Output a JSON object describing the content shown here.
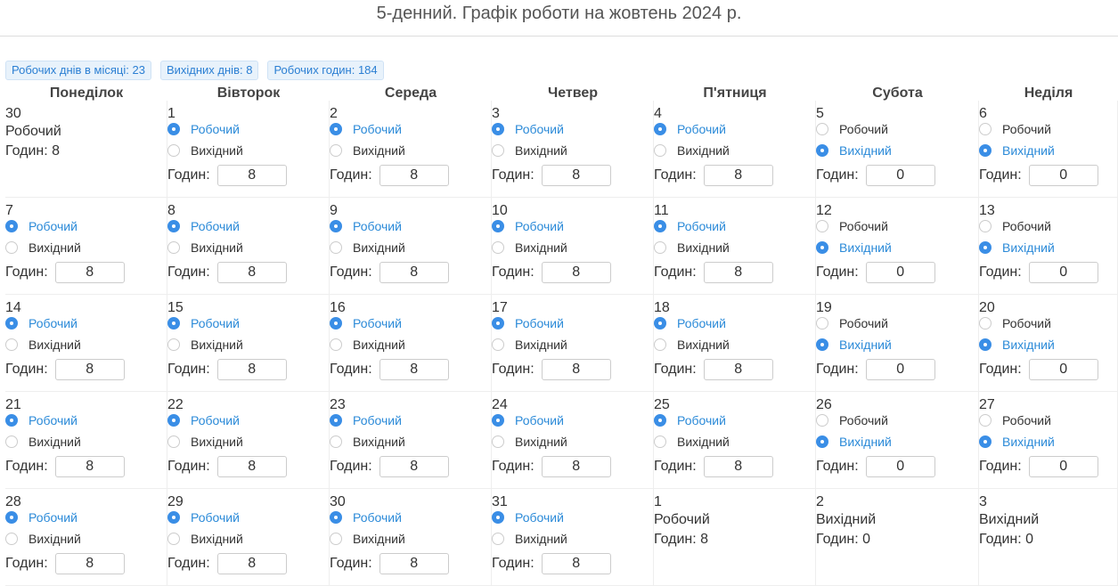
{
  "title": "5-денний. Графік роботи на жовтень 2024 р.",
  "badges": {
    "working_days": "Робочих днів в місяці: 23",
    "days_off": "Вихідних днів: 8",
    "working_hours": "Робочих годин: 184"
  },
  "labels": {
    "work": "Робочий",
    "off": "Вихідний",
    "hours": "Годин:"
  },
  "weekdays": [
    "Понеділок",
    "Вівторок",
    "Середа",
    "Четвер",
    "П'ятниця",
    "Субота",
    "Неділя"
  ],
  "weeks": [
    [
      {
        "day": "30",
        "editable": false,
        "type_text": "Робочий",
        "hours_text": "Годин: 8"
      },
      {
        "day": "1",
        "editable": true,
        "working": true,
        "hours": "8"
      },
      {
        "day": "2",
        "editable": true,
        "working": true,
        "hours": "8"
      },
      {
        "day": "3",
        "editable": true,
        "working": true,
        "hours": "8"
      },
      {
        "day": "4",
        "editable": true,
        "working": true,
        "hours": "8"
      },
      {
        "day": "5",
        "editable": true,
        "working": false,
        "hours": "0"
      },
      {
        "day": "6",
        "editable": true,
        "working": false,
        "hours": "0"
      }
    ],
    [
      {
        "day": "7",
        "editable": true,
        "working": true,
        "hours": "8"
      },
      {
        "day": "8",
        "editable": true,
        "working": true,
        "hours": "8"
      },
      {
        "day": "9",
        "editable": true,
        "working": true,
        "hours": "8"
      },
      {
        "day": "10",
        "editable": true,
        "working": true,
        "hours": "8"
      },
      {
        "day": "11",
        "editable": true,
        "working": true,
        "hours": "8"
      },
      {
        "day": "12",
        "editable": true,
        "working": false,
        "hours": "0"
      },
      {
        "day": "13",
        "editable": true,
        "working": false,
        "hours": "0"
      }
    ],
    [
      {
        "day": "14",
        "editable": true,
        "working": true,
        "hours": "8"
      },
      {
        "day": "15",
        "editable": true,
        "working": true,
        "hours": "8"
      },
      {
        "day": "16",
        "editable": true,
        "working": true,
        "hours": "8"
      },
      {
        "day": "17",
        "editable": true,
        "working": true,
        "hours": "8"
      },
      {
        "day": "18",
        "editable": true,
        "working": true,
        "hours": "8"
      },
      {
        "day": "19",
        "editable": true,
        "working": false,
        "hours": "0"
      },
      {
        "day": "20",
        "editable": true,
        "working": false,
        "hours": "0"
      }
    ],
    [
      {
        "day": "21",
        "editable": true,
        "working": true,
        "hours": "8"
      },
      {
        "day": "22",
        "editable": true,
        "working": true,
        "hours": "8"
      },
      {
        "day": "23",
        "editable": true,
        "working": true,
        "hours": "8"
      },
      {
        "day": "24",
        "editable": true,
        "working": true,
        "hours": "8"
      },
      {
        "day": "25",
        "editable": true,
        "working": true,
        "hours": "8"
      },
      {
        "day": "26",
        "editable": true,
        "working": false,
        "hours": "0"
      },
      {
        "day": "27",
        "editable": true,
        "working": false,
        "hours": "0"
      }
    ],
    [
      {
        "day": "28",
        "editable": true,
        "working": true,
        "hours": "8"
      },
      {
        "day": "29",
        "editable": true,
        "working": true,
        "hours": "8"
      },
      {
        "day": "30",
        "editable": true,
        "working": true,
        "hours": "8"
      },
      {
        "day": "31",
        "editable": true,
        "working": true,
        "hours": "8"
      },
      {
        "day": "1",
        "editable": false,
        "type_text": "Робочий",
        "hours_text": "Годин: 8"
      },
      {
        "day": "2",
        "editable": false,
        "type_text": "Вихідний",
        "hours_text": "Годин: 0"
      },
      {
        "day": "3",
        "editable": false,
        "type_text": "Вихідний",
        "hours_text": "Годин: 0"
      }
    ]
  ]
}
